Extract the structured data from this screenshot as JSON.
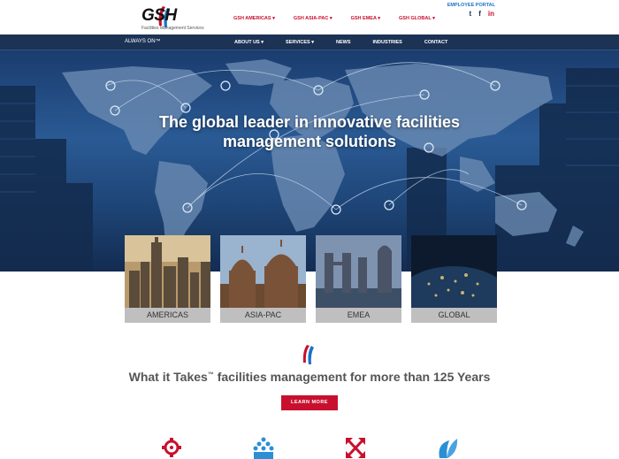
{
  "header": {
    "logo_text": "GSH",
    "logo_tagline": "Facilities Management Services",
    "employee_portal": "EMPLOYEE PORTAL",
    "regions": [
      "GSH AMERICAS ▾",
      "GSH ASIA-PAC ▾",
      "GSH EMEA ▾",
      "GSH GLOBAL ▾"
    ],
    "social": {
      "twitter": "t",
      "facebook": "f",
      "linkedin": "in"
    }
  },
  "navbar": {
    "slogan": "ALWAYS ON™",
    "items": [
      "ABOUT US ▾",
      "SERVICES ▾",
      "NEWS",
      "INDUSTRIES",
      "CONTACT"
    ]
  },
  "hero": {
    "title_line1": "The global leader in innovative facilities",
    "title_line2": "management solutions"
  },
  "cards": [
    "AMERICAS",
    "ASIA-PAC",
    "EMEA",
    "GLOBAL"
  ],
  "section": {
    "tagline_pre": "What it Takes",
    "tagline_tm": "™",
    "tagline_post": " facilities management for more than 125 Years",
    "button": "LEARN MORE"
  },
  "colors": {
    "brand_red": "#c8102e",
    "brand_blue": "#1c3356",
    "link_blue": "#1a73c6",
    "icon_blue": "#2b8fd6"
  },
  "icons": [
    "gear-icon",
    "people-icon",
    "expand-arrows-icon",
    "leaf-icon"
  ]
}
